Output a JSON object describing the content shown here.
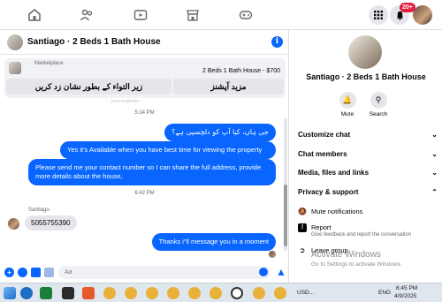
{
  "nav": {
    "icons": [
      "home-icon",
      "friends-icon",
      "video-icon",
      "marketplace-icon",
      "gaming-icon"
    ],
    "notification_count": "20+",
    "colors": {
      "accent": "#0866ff",
      "badge": "#e41e3f"
    }
  },
  "chat": {
    "header_title": "Santiago · 2 Beds 1 Bath House",
    "marketplace_label": "Marketplace",
    "listing_text": "2 Beds 1 Bath House - $700",
    "action_left": "زیر التواء کے بطور نشان زد کریں",
    "action_right": "مزید آپشنز",
    "faded_note": "... your response.",
    "messages": {
      "time1": "5:14 PM",
      "urdu_question": "جی ہاں، کیا آپ کو دلچسپی ہے؟",
      "available": "Yes it's Available when you have best time for viewing the property",
      "request": "Please send me your contact number so I can share the full address, provide more details about the house,",
      "time2": "6:42 PM",
      "sender": "Santiago",
      "phone": "5055755390",
      "reply": "Thanks i\"ll message you in a moment"
    },
    "composer_placeholder": "Aa"
  },
  "side": {
    "title": "Santiago · 2 Beds 1 Bath House",
    "mute_label": "Mute",
    "search_label": "Search",
    "sections": [
      "Customize chat",
      "Chat members",
      "Media, files and links",
      "Privacy & support"
    ],
    "mute_notifications": "Mute notifications",
    "report": "Report",
    "report_sub": "Give feedback and report the conversation",
    "leave_group": "Leave group",
    "activate_title": "Activate Windows",
    "activate_sub": "Go to Settings to activate Windows."
  },
  "taskbar": {
    "currency": "USD...",
    "lang": "ENG",
    "time": "6:45 PM",
    "date": "4/9/2025"
  }
}
